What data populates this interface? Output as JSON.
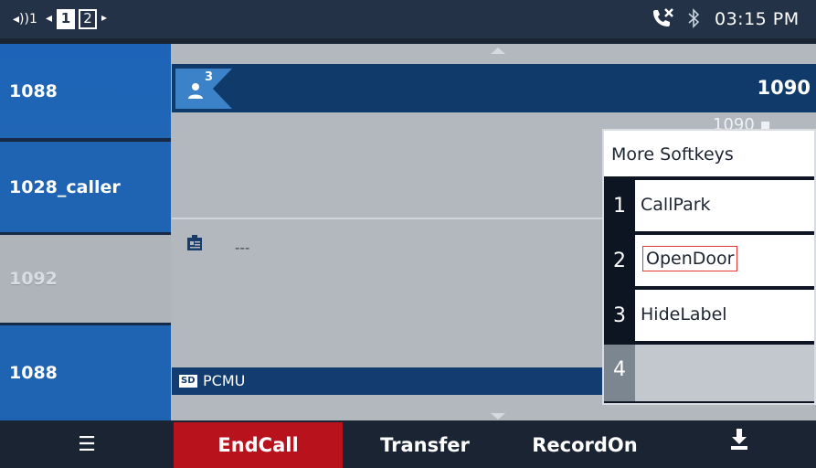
{
  "status_bar": {
    "volume": "◂))1",
    "page_prev": "◂",
    "page_active": "1",
    "page_other": "2",
    "page_next": "▸",
    "call_forward_icon": "call-forward-icon",
    "bluetooth_icon": "bluetooth-icon",
    "clock": "03:15 PM"
  },
  "line_keys": [
    {
      "label": "1088",
      "state": "active"
    },
    {
      "label": "1028_caller",
      "state": "active"
    },
    {
      "label": "1092",
      "state": "inactive"
    },
    {
      "label": "1088",
      "state": "active"
    }
  ],
  "call": {
    "conference_count": "3",
    "contact_number": "1090",
    "sub_number": "1090 ▪",
    "info_text": "---",
    "codec_badge": "SD",
    "codec": "PCMU"
  },
  "more_softkeys": {
    "title": "More Softkeys",
    "items": [
      {
        "num": "1",
        "label": "CallPark"
      },
      {
        "num": "2",
        "label": "OpenDoor"
      },
      {
        "num": "3",
        "label": "HideLabel"
      },
      {
        "num": "4",
        "label": ""
      }
    ]
  },
  "softkeys": {
    "menu_icon": "☰",
    "end_call": "EndCall",
    "transfer": "Transfer",
    "record_on": "RecordOn",
    "more_icon": "⏏"
  },
  "colors": {
    "end_call": "#b8121c",
    "line_key_active": "#1f64b2",
    "line_key_inactive": "#aeb4ba",
    "contact_bar": "#0f3a6a",
    "selection_outline": "#e53a3a"
  }
}
